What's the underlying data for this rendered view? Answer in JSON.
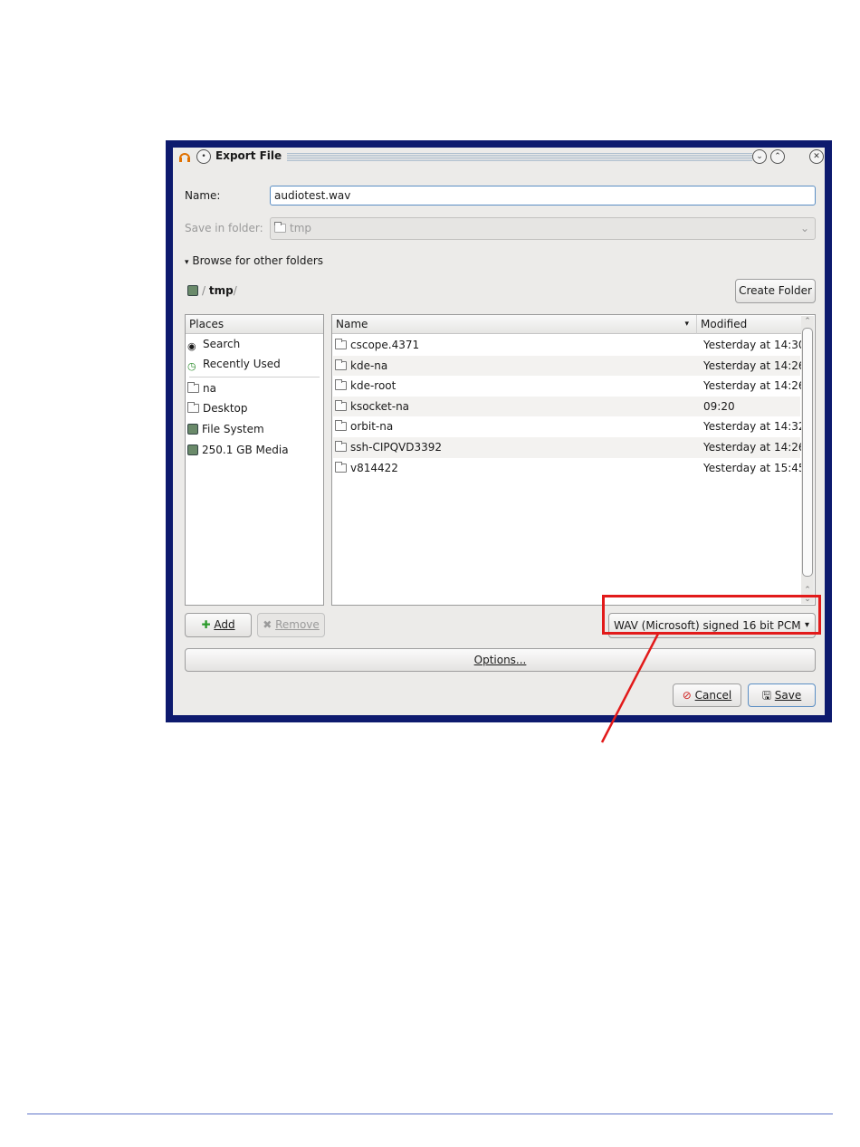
{
  "dialog": {
    "title": "Export File",
    "name_label": "Name:",
    "name_value": "audiotest.wav",
    "save_in_label": "Save in folder:",
    "save_in_value": "tmp",
    "browse_label": "Browse for other folders",
    "breadcrumb": {
      "sep1": "/",
      "current": "tmp",
      "sep2": "/"
    },
    "create_folder_label": "Create Folder",
    "places": {
      "header": "Places",
      "items": [
        {
          "label": "Search",
          "icon": "binoculars-icon"
        },
        {
          "label": "Recently Used",
          "icon": "clock-icon"
        },
        {
          "label": "na",
          "icon": "folder-icon"
        },
        {
          "label": "Desktop",
          "icon": "folder-icon"
        },
        {
          "label": "File System",
          "icon": "drive-icon"
        },
        {
          "label": "250.1 GB Media",
          "icon": "drive-icon"
        }
      ]
    },
    "files": {
      "col_name": "Name",
      "col_modified": "Modified",
      "rows": [
        {
          "name": "cscope.4371",
          "modified": "Yesterday at 14:30"
        },
        {
          "name": "kde-na",
          "modified": "Yesterday at 14:26"
        },
        {
          "name": "kde-root",
          "modified": "Yesterday at 14:26"
        },
        {
          "name": "ksocket-na",
          "modified": "09:20"
        },
        {
          "name": "orbit-na",
          "modified": "Yesterday at 14:32"
        },
        {
          "name": "ssh-CIPQVD3392",
          "modified": "Yesterday at 14:26"
        },
        {
          "name": "v814422",
          "modified": "Yesterday at 15:45"
        }
      ]
    },
    "add_label": "Add",
    "remove_label": "Remove",
    "filetype_value": "WAV (Microsoft) signed 16 bit PCM",
    "options_label": "Options...",
    "cancel_label": "Cancel",
    "save_label": "Save"
  },
  "colors": {
    "frame": "#0d1a6e",
    "annotation": "#e21a1a",
    "footer_rule": "#5e73c9"
  }
}
